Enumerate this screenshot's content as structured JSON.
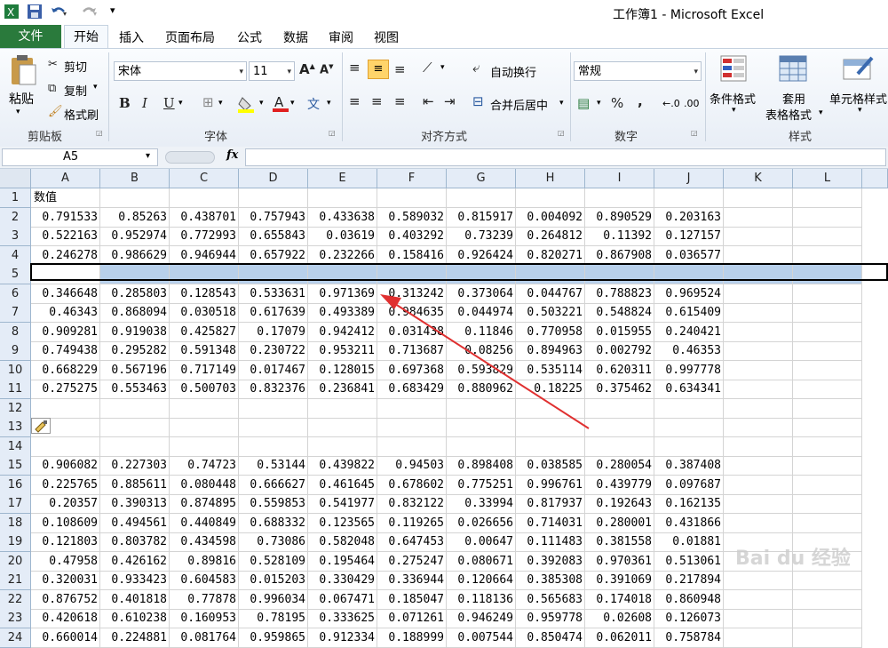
{
  "app": {
    "title": "工作簿1 - Microsoft Excel"
  },
  "tabs": [
    "文件",
    "开始",
    "插入",
    "页面布局",
    "公式",
    "数据",
    "审阅",
    "视图"
  ],
  "ribbon": {
    "clipboard": {
      "paste": "粘贴",
      "cut": "剪切",
      "copy": "复制",
      "format_painter": "格式刷",
      "label": "剪贴板"
    },
    "font": {
      "name": "宋体",
      "size": "11",
      "label": "字体"
    },
    "alignment": {
      "wrap": "自动换行",
      "merge": "合并后居中",
      "label": "对齐方式"
    },
    "number": {
      "format": "常规",
      "percent": "%",
      "comma": ",",
      "label": "数字"
    },
    "styles": {
      "conditional": "条件格式",
      "table_line1": "套用",
      "table_line2": "表格格式",
      "cell": "单元格样式",
      "label": "样式"
    }
  },
  "formula_bar": {
    "name_box": "A5",
    "fx": "fx",
    "value": ""
  },
  "columns": [
    "A",
    "B",
    "C",
    "D",
    "E",
    "F",
    "G",
    "H",
    "I",
    "J",
    "K",
    "L"
  ],
  "rows": [
    {
      "num": "1",
      "cells": [
        "数值"
      ]
    },
    {
      "num": "2",
      "cells": [
        "0.791533",
        "0.85263",
        "0.438701",
        "0.757943",
        "0.433638",
        "0.589032",
        "0.815917",
        "0.004092",
        "0.890529",
        "0.203163"
      ]
    },
    {
      "num": "3",
      "cells": [
        "0.522163",
        "0.952974",
        "0.772993",
        "0.655843",
        "0.03619",
        "0.403292",
        "0.73239",
        "0.264812",
        "0.11392",
        "0.127157"
      ]
    },
    {
      "num": "4",
      "cells": [
        "0.246278",
        "0.986629",
        "0.946944",
        "0.657922",
        "0.232266",
        "0.158416",
        "0.926424",
        "0.820271",
        "0.867908",
        "0.036577"
      ]
    },
    {
      "num": "5",
      "cells": []
    },
    {
      "num": "6",
      "cells": [
        "0.346648",
        "0.285803",
        "0.128543",
        "0.533631",
        "0.971369",
        "0.313242",
        "0.373064",
        "0.044767",
        "0.788823",
        "0.969524"
      ]
    },
    {
      "num": "7",
      "cells": [
        "0.46343",
        "0.868094",
        "0.030518",
        "0.617639",
        "0.493389",
        "0.984635",
        "0.044974",
        "0.503221",
        "0.548824",
        "0.615409"
      ]
    },
    {
      "num": "8",
      "cells": [
        "0.909281",
        "0.919038",
        "0.425827",
        "0.17079",
        "0.942412",
        "0.031438",
        "0.11846",
        "0.770958",
        "0.015955",
        "0.240421"
      ]
    },
    {
      "num": "9",
      "cells": [
        "0.749438",
        "0.295282",
        "0.591348",
        "0.230722",
        "0.953211",
        "0.713687",
        "0.08256",
        "0.894963",
        "0.002792",
        "0.46353"
      ]
    },
    {
      "num": "10",
      "cells": [
        "0.668229",
        "0.567196",
        "0.717149",
        "0.017467",
        "0.128015",
        "0.697368",
        "0.593829",
        "0.535114",
        "0.620311",
        "0.997778"
      ]
    },
    {
      "num": "11",
      "cells": [
        "0.275275",
        "0.553463",
        "0.500703",
        "0.832376",
        "0.236841",
        "0.683429",
        "0.880962",
        "0.18225",
        "0.375462",
        "0.634341"
      ]
    },
    {
      "num": "12",
      "cells": []
    },
    {
      "num": "13",
      "cells": []
    },
    {
      "num": "14",
      "cells": []
    },
    {
      "num": "15",
      "cells": [
        "0.906082",
        "0.227303",
        "0.74723",
        "0.53144",
        "0.439822",
        "0.94503",
        "0.898408",
        "0.038585",
        "0.280054",
        "0.387408"
      ]
    },
    {
      "num": "16",
      "cells": [
        "0.225765",
        "0.885611",
        "0.080448",
        "0.666627",
        "0.461645",
        "0.678602",
        "0.775251",
        "0.996761",
        "0.439779",
        "0.097687"
      ]
    },
    {
      "num": "17",
      "cells": [
        "0.20357",
        "0.390313",
        "0.874895",
        "0.559853",
        "0.541977",
        "0.832122",
        "0.33994",
        "0.817937",
        "0.192643",
        "0.162135"
      ]
    },
    {
      "num": "18",
      "cells": [
        "0.108609",
        "0.494561",
        "0.440849",
        "0.688332",
        "0.123565",
        "0.119265",
        "0.026656",
        "0.714031",
        "0.280001",
        "0.431866"
      ]
    },
    {
      "num": "19",
      "cells": [
        "0.121803",
        "0.803782",
        "0.434598",
        "0.73086",
        "0.582048",
        "0.647453",
        "0.00647",
        "0.111483",
        "0.381558",
        "0.01881"
      ]
    },
    {
      "num": "20",
      "cells": [
        "0.47958",
        "0.426162",
        "0.89816",
        "0.528109",
        "0.195464",
        "0.275247",
        "0.080671",
        "0.392083",
        "0.970361",
        "0.513061"
      ]
    },
    {
      "num": "21",
      "cells": [
        "0.320031",
        "0.933423",
        "0.604583",
        "0.015203",
        "0.330429",
        "0.336944",
        "0.120664",
        "0.385308",
        "0.391069",
        "0.217894"
      ]
    },
    {
      "num": "22",
      "cells": [
        "0.876752",
        "0.401818",
        "0.77878",
        "0.996034",
        "0.067471",
        "0.185047",
        "0.118136",
        "0.565683",
        "0.174018",
        "0.860948"
      ]
    },
    {
      "num": "23",
      "cells": [
        "0.420618",
        "0.610238",
        "0.160953",
        "0.78195",
        "0.333625",
        "0.071261",
        "0.946249",
        "0.959778",
        "0.02608",
        "0.126073"
      ]
    },
    {
      "num": "24",
      "cells": [
        "0.660014",
        "0.224881",
        "0.081764",
        "0.959865",
        "0.912334",
        "0.188999",
        "0.007544",
        "0.850474",
        "0.062011",
        "0.758784"
      ]
    }
  ],
  "colors": {
    "file_tab": "#2a7a3c",
    "selection": "#b8d0eb",
    "arrow": "#e03030"
  }
}
